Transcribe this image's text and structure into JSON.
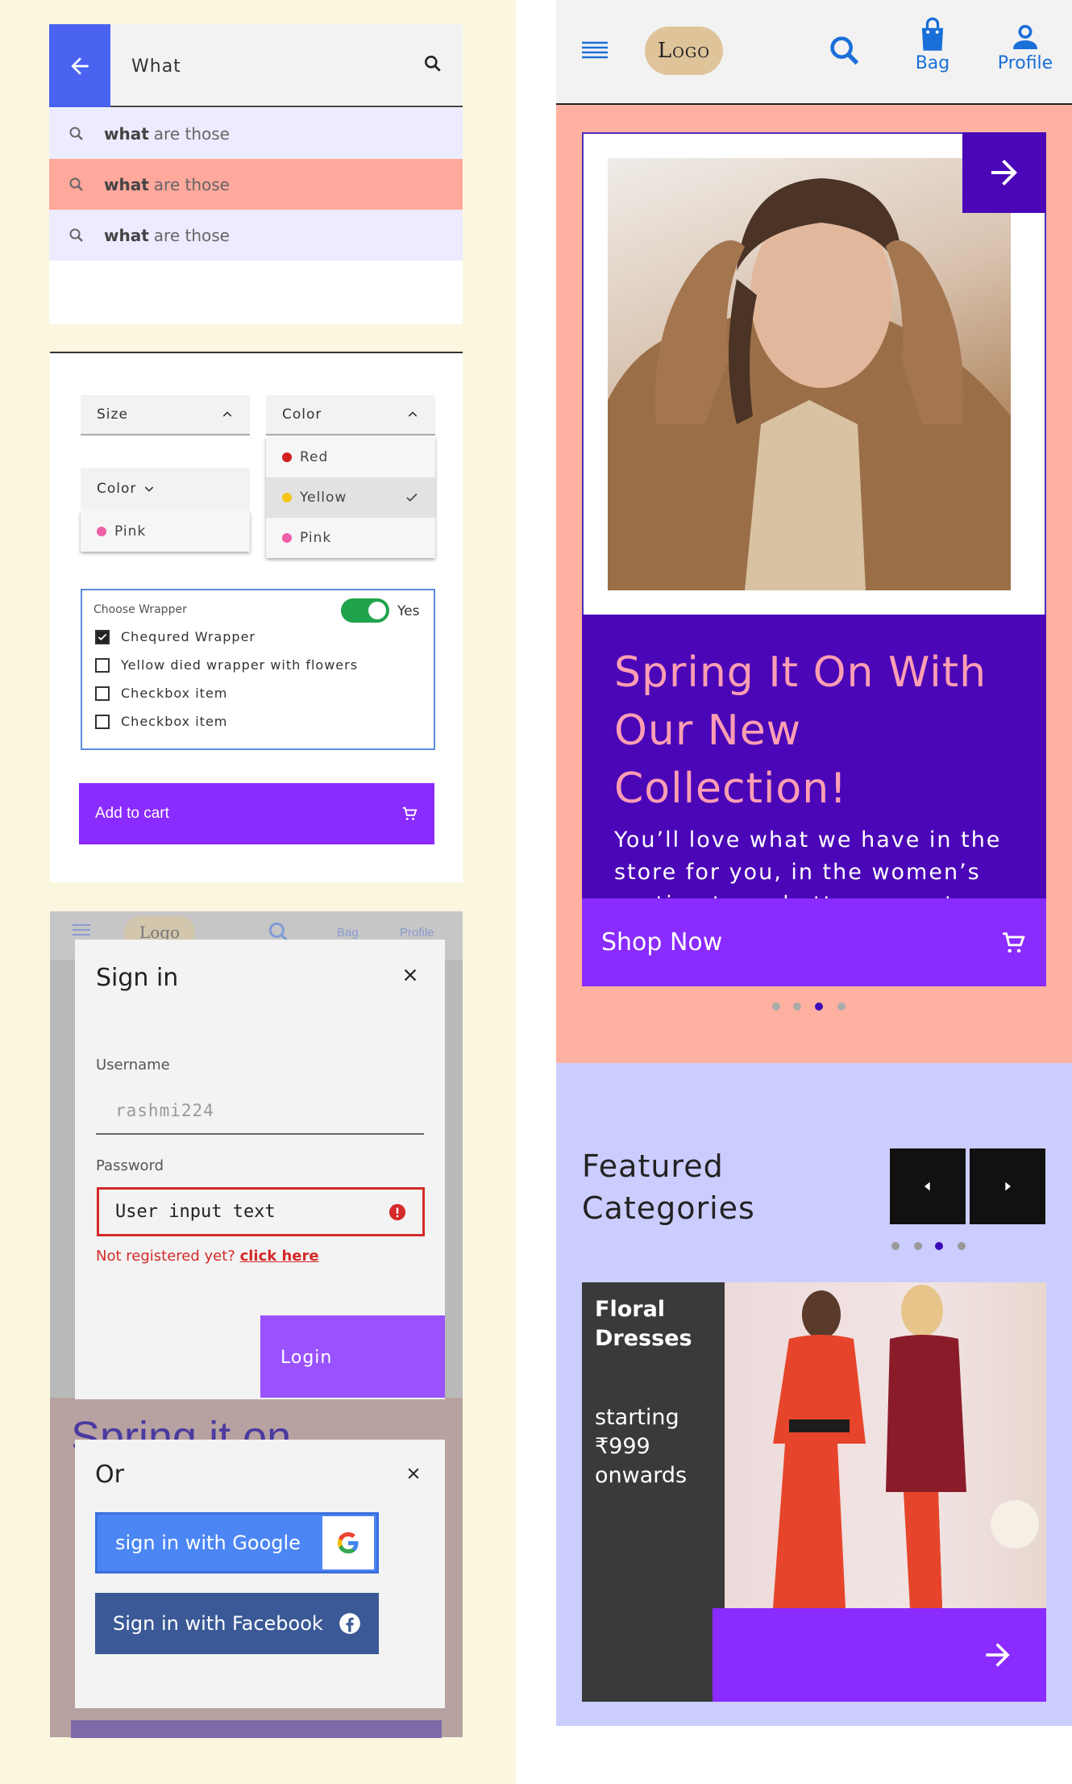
{
  "search": {
    "query": "What",
    "suggestions": [
      {
        "bold": "what",
        "rest": "are those"
      },
      {
        "bold": "what",
        "rest": "are those"
      },
      {
        "bold": "what",
        "rest": "are those"
      }
    ]
  },
  "filters": {
    "size_label": "Size",
    "color_label": "Color",
    "color_options": [
      {
        "label": "Red",
        "color": "#d11f1f"
      },
      {
        "label": "Yellow",
        "color": "#f5c518",
        "selected": true
      },
      {
        "label": "Pink",
        "color": "#ef5fa7"
      }
    ],
    "color_label_2": "Color",
    "color_options_2": [
      {
        "label": "Pink",
        "color": "#ef5fa7"
      }
    ]
  },
  "wrapper": {
    "legend": "Choose Wrapper",
    "toggle_label": "Yes",
    "options": [
      {
        "label": "Chequred Wrapper",
        "checked": true
      },
      {
        "label": "Yellow died wrapper with flowers",
        "checked": false
      },
      {
        "label": "Checkbox item",
        "checked": false
      },
      {
        "label": "Checkbox item",
        "checked": false
      }
    ]
  },
  "add_to_cart": "Add to cart",
  "signin": {
    "title": "Sign in",
    "username_label": "Username",
    "username_value": "rashmi224",
    "password_label": "Password",
    "password_value": "User input text",
    "not_registered": "Not registered yet?",
    "click_here": "click here",
    "login": "Login",
    "ghost_logo": "Logo",
    "ghost_bag": "Bag",
    "ghost_profile": "Profile",
    "ghost_heading": "Spring it on"
  },
  "social": {
    "title": "Or",
    "google": "sign in with Google",
    "facebook": "Sign in with Facebook"
  },
  "nav": {
    "logo": "Logo",
    "bag": "Bag",
    "profile": "Profile"
  },
  "hero": {
    "title_line1": "Spring It On With",
    "title_line2": "Our New Collection!",
    "body": "You’ll love what we have in the store for you, in the women’s section tops, bottoms, coats and shoes.",
    "cta": "Shop Now",
    "carousel_total": 4,
    "carousel_active": 3
  },
  "featured": {
    "title_line1": "Featured",
    "title_line2": "Categories",
    "carousel_total": 4,
    "carousel_active": 3,
    "card": {
      "name_line1": "Floral",
      "name_line2": "Dresses",
      "price_line1": "starting",
      "price_line2": "₹999",
      "price_line3": "onwards"
    }
  },
  "colors": {
    "primary": "#8a2bff",
    "deep_purple": "#4b06b8",
    "blue": "#4a62f0",
    "link_blue": "#1a6fd8",
    "error": "#d42a2a"
  }
}
